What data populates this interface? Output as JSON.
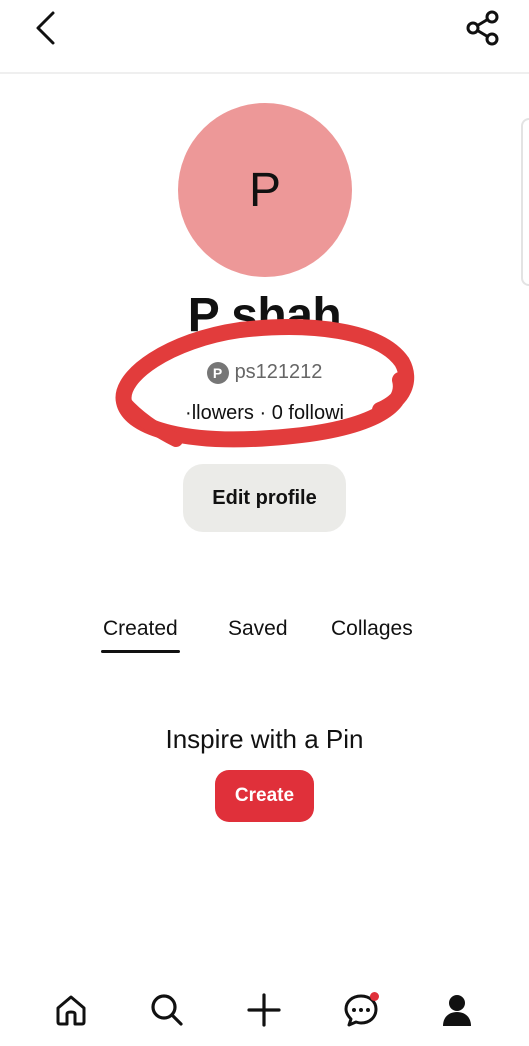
{
  "header": {
    "back_icon": "chevron-left-icon",
    "share_icon": "share-icon"
  },
  "profile": {
    "avatar_letter": "P",
    "avatar_color": "#ed9898",
    "display_name": "P shah",
    "username": "ps121212",
    "platform_icon": "pinterest-icon",
    "pinterest_logo_letter": "P",
    "stats_visible": "·llowers · 0 followi",
    "edit_button_label": "Edit profile"
  },
  "annotation": {
    "type": "hand-drawn circle",
    "color": "#e23c3c"
  },
  "tabs": [
    {
      "label": "Created",
      "active": true
    },
    {
      "label": "Saved",
      "active": false
    },
    {
      "label": "Collages",
      "active": false
    }
  ],
  "empty_state": {
    "message": "Inspire with a Pin",
    "create_button_label": "Create",
    "accent_color": "#e0303a"
  },
  "bottom_nav": {
    "items": [
      {
        "icon": "home-icon"
      },
      {
        "icon": "search-icon"
      },
      {
        "icon": "plus-icon"
      },
      {
        "icon": "messages-icon",
        "notification": true
      },
      {
        "icon": "profile-icon"
      }
    ]
  }
}
